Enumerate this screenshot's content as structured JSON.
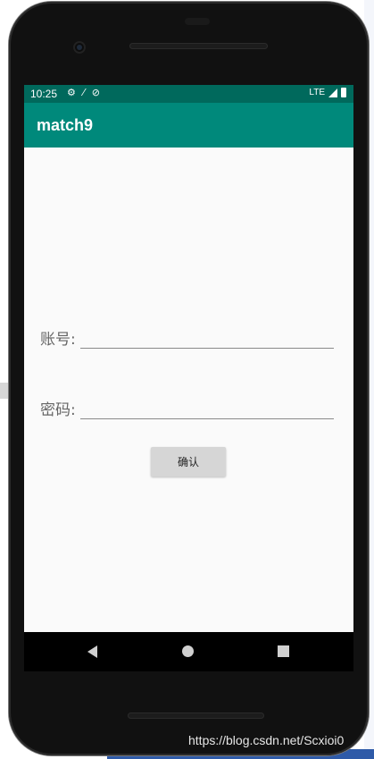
{
  "status_bar": {
    "time": "10:25",
    "network": "LTE",
    "icons_left": [
      "gear-icon",
      "signal-off-icon",
      "sync-icon"
    ],
    "icons_right": [
      "signal-icon",
      "battery-icon"
    ]
  },
  "app_bar": {
    "title": "match9"
  },
  "form": {
    "account_label": "账号:",
    "account_value": "",
    "password_label": "密码:",
    "password_value": "",
    "confirm_label": "确认"
  },
  "nav_bar": {
    "icons": [
      "back-icon",
      "home-icon",
      "recents-icon"
    ]
  },
  "watermark": "https://blog.csdn.net/Scxioi0",
  "colors": {
    "status_bar": "#00695c",
    "app_bar": "#00897b",
    "screen_bg": "#fafafa",
    "button_bg": "#d6d6d6"
  }
}
